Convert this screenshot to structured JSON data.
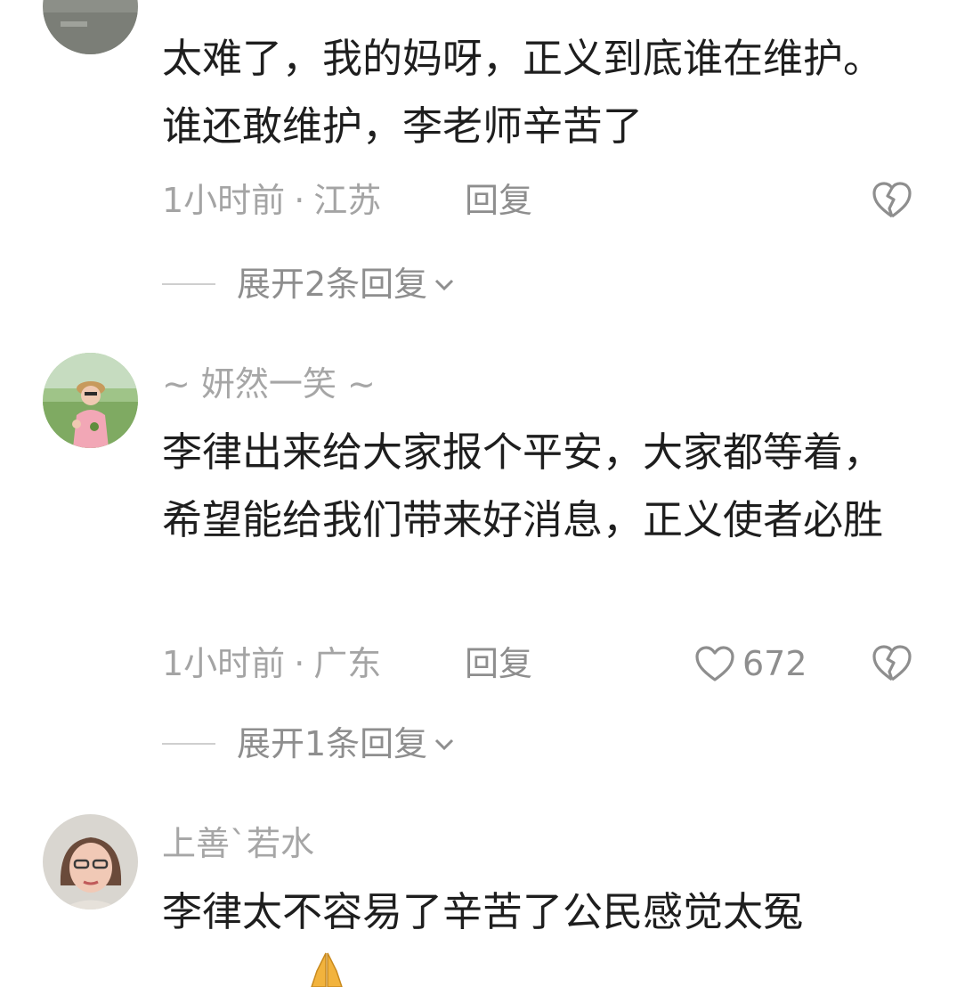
{
  "comments": [
    {
      "username": "",
      "text": "太难了，我的妈呀，正义到底谁在维护。谁还敢维护，李老师辛苦了",
      "time": "1小时前",
      "location": "江苏",
      "reply_label": "回复",
      "likes": "",
      "expand_label": "展开2条回复"
    },
    {
      "username": "~ 妍然一笑 ~",
      "text": "李律出来给大家报个平安，大家都等着，希望能给我们带来好消息，正义使者必胜",
      "time": "1小时前",
      "location": "广东",
      "reply_label": "回复",
      "likes": "672",
      "expand_label": "展开1条回复"
    },
    {
      "username": "上善`若水",
      "text": "李律太不容易了辛苦了公民感觉太冤"
    }
  ],
  "meta_separator": "·",
  "icons": {
    "like": "heart-outline-icon",
    "dislike": "broken-heart-icon",
    "expand": "chevron-down-icon",
    "emoji": "praying-hands-emoji"
  },
  "colors": {
    "text": "#1e1e1e",
    "muted": "#a4a4a4",
    "icon": "#8e8e8e",
    "emoji": "#f2b33d"
  }
}
